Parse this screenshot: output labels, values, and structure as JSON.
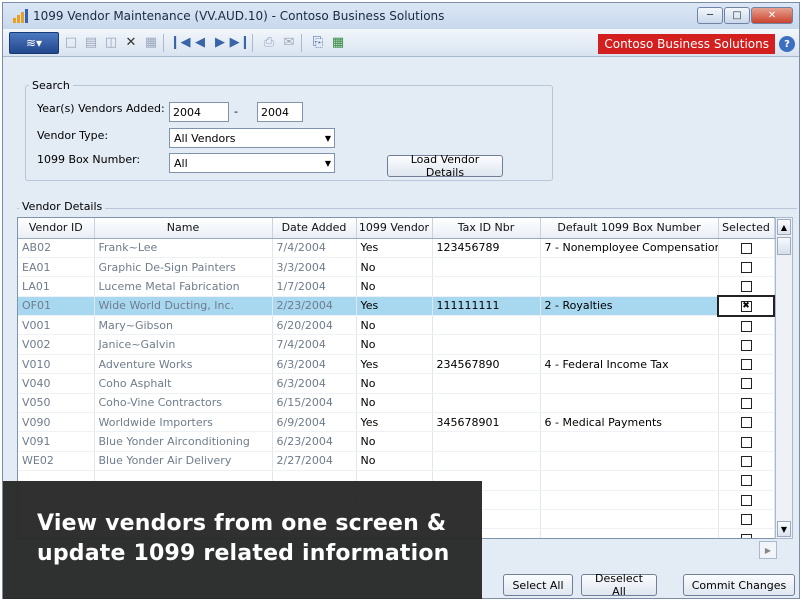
{
  "window": {
    "title": "1099 Vendor Maintenance (VV.AUD.10) - Contoso Business Solutions",
    "brand": "Contoso Business Solutions"
  },
  "search": {
    "group_label": "Search",
    "years_label": "Year(s) Vendors Added:",
    "year_from": "2004",
    "year_to": "2004",
    "dash": "-",
    "vendor_type_label": "Vendor Type:",
    "vendor_type_value": "All Vendors",
    "box_label": "1099 Box Number:",
    "box_value": "All",
    "load_button": "Load Vendor Details"
  },
  "details": {
    "group_label": "Vendor Details",
    "columns": [
      "Vendor ID",
      "Name",
      "Date Added",
      "1099 Vendor",
      "Tax ID Nbr",
      "Default 1099 Box Number",
      "Selected"
    ],
    "rows": [
      {
        "id": "AB02",
        "name": "Frank~Lee",
        "date": "7/4/2004",
        "vendor": "Yes",
        "tax": "123456789",
        "box": "7 - Nonemployee Compensation",
        "selected": false
      },
      {
        "id": "EA01",
        "name": "Graphic De-Sign Painters",
        "date": "3/3/2004",
        "vendor": "No",
        "tax": "",
        "box": "",
        "selected": false
      },
      {
        "id": "LA01",
        "name": "Luceme Metal Fabrication",
        "date": "1/7/2004",
        "vendor": "No",
        "tax": "",
        "box": "",
        "selected": false
      },
      {
        "id": "OF01",
        "name": "Wide World Ducting, Inc.",
        "date": "2/23/2004",
        "vendor": "Yes",
        "tax": "111111111",
        "box": "2 - Royalties",
        "selected": true
      },
      {
        "id": "V001",
        "name": "Mary~Gibson",
        "date": "6/20/2004",
        "vendor": "No",
        "tax": "",
        "box": "",
        "selected": false
      },
      {
        "id": "V002",
        "name": "Janice~Galvin",
        "date": "7/4/2004",
        "vendor": "No",
        "tax": "",
        "box": "",
        "selected": false
      },
      {
        "id": "V010",
        "name": "Adventure Works",
        "date": "6/3/2004",
        "vendor": "Yes",
        "tax": "234567890",
        "box": "4 - Federal Income Tax",
        "selected": false
      },
      {
        "id": "V040",
        "name": "Coho Asphalt",
        "date": "6/3/2004",
        "vendor": "No",
        "tax": "",
        "box": "",
        "selected": false
      },
      {
        "id": "V050",
        "name": "Coho-Vine Contractors",
        "date": "6/15/2004",
        "vendor": "No",
        "tax": "",
        "box": "",
        "selected": false
      },
      {
        "id": "V090",
        "name": "Worldwide Importers",
        "date": "6/9/2004",
        "vendor": "Yes",
        "tax": "345678901",
        "box": "6 - Medical Payments",
        "selected": false
      },
      {
        "id": "V091",
        "name": "Blue Yonder Airconditioning",
        "date": "6/23/2004",
        "vendor": "No",
        "tax": "",
        "box": "",
        "selected": false
      },
      {
        "id": "WE02",
        "name": "Blue Yonder Air Delivery",
        "date": "2/27/2004",
        "vendor": "No",
        "tax": "",
        "box": "",
        "selected": false
      },
      {
        "id": "",
        "name": "",
        "date": "",
        "vendor": "",
        "tax": "",
        "box": "",
        "selected": false
      },
      {
        "id": "",
        "name": "",
        "date": "",
        "vendor": "",
        "tax": "",
        "box": "",
        "selected": false
      },
      {
        "id": "",
        "name": "",
        "date": "",
        "vendor": "",
        "tax": "",
        "box": "",
        "selected": false
      },
      {
        "id": "",
        "name": "",
        "date": "",
        "vendor": "",
        "tax": "",
        "box": "",
        "selected": false
      },
      {
        "id": "",
        "name": "",
        "date": "",
        "vendor": "",
        "tax": "",
        "box": "",
        "selected": false
      }
    ]
  },
  "actions": {
    "select_all": "Select All",
    "deselect_all": "Deselect All",
    "commit": "Commit Changes"
  },
  "overlay": {
    "line1": "View vendors from one screen &",
    "line2": "update 1099 related information"
  },
  "icons": [
    "app-logo-icon",
    "new-icon",
    "save-icon",
    "copy-icon",
    "delete-icon",
    "first-icon",
    "prev-icon",
    "next-icon",
    "last-icon",
    "print-icon",
    "export-icon",
    "help-icon"
  ],
  "colors": {
    "brand_badge": "#d41f1f",
    "selected_row": "#a8d8ef",
    "menu_button": "#2d56a0"
  }
}
